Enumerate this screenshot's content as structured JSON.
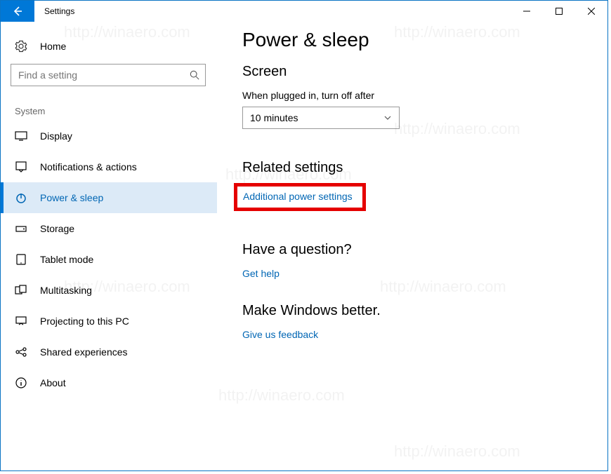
{
  "window": {
    "title": "Settings"
  },
  "sidebar": {
    "home": "Home",
    "search_placeholder": "Find a setting",
    "group": "System",
    "items": [
      {
        "label": "Display",
        "icon": "display-icon"
      },
      {
        "label": "Notifications & actions",
        "icon": "notifications-icon"
      },
      {
        "label": "Power & sleep",
        "icon": "power-icon",
        "active": true
      },
      {
        "label": "Storage",
        "icon": "storage-icon"
      },
      {
        "label": "Tablet mode",
        "icon": "tablet-icon"
      },
      {
        "label": "Multitasking",
        "icon": "multitasking-icon"
      },
      {
        "label": "Projecting to this PC",
        "icon": "projecting-icon"
      },
      {
        "label": "Shared experiences",
        "icon": "shared-icon"
      },
      {
        "label": "About",
        "icon": "about-icon"
      }
    ]
  },
  "main": {
    "title": "Power & sleep",
    "screen": {
      "heading": "Screen",
      "label": "When plugged in, turn off after",
      "value": "10 minutes"
    },
    "related": {
      "heading": "Related settings",
      "link": "Additional power settings"
    },
    "question": {
      "heading": "Have a question?",
      "link": "Get help"
    },
    "better": {
      "heading": "Make Windows better.",
      "link": "Give us feedback"
    }
  },
  "watermark": "http://winaero.com"
}
